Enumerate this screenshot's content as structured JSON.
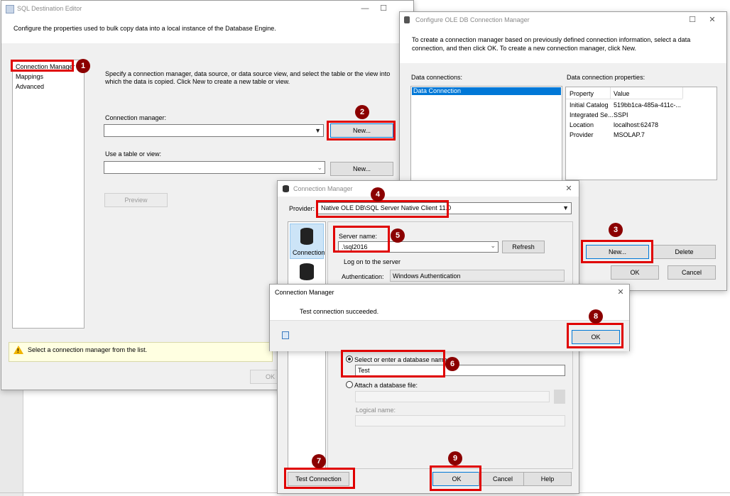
{
  "sql_editor": {
    "title": "SQL Destination Editor",
    "description": "Configure the properties used to bulk copy data into a local instance of the Database Engine.",
    "nav": [
      "Connection Manager",
      "Mappings",
      "Advanced"
    ],
    "instructions": "Specify a connection manager, data source, or data source view, and select the table or the view into which the data is copied. Click New to create a new table or view.",
    "conn_label": "Connection manager:",
    "new1": "New...",
    "table_label": "Use a table or view:",
    "new2": "New...",
    "preview": "Preview",
    "warning": "Select a connection manager from the list.",
    "ok_partial": "OK"
  },
  "oledb": {
    "title": "Configure OLE DB Connection Manager",
    "description": "To create a connection manager based on previously defined connection information, select a data connection, and then click OK. To create a new connection manager, click New.",
    "data_connections_label": "Data connections:",
    "data_connections": [
      "Data Connection"
    ],
    "props_label": "Data connection properties:",
    "props_headers": [
      "Property",
      "Value"
    ],
    "props": [
      {
        "p": "Initial Catalog",
        "v": "519bb1ca-485a-411c-..."
      },
      {
        "p": "Integrated Se...",
        "v": "SSPI"
      },
      {
        "p": "Location",
        "v": "localhost:62478"
      },
      {
        "p": "Provider",
        "v": "MSOLAP.7"
      }
    ],
    "new": "New...",
    "delete": "Delete",
    "ok": "OK",
    "cancel": "Cancel"
  },
  "conn_mgr": {
    "title": "Connection Manager",
    "provider_label": "Provider:",
    "provider": "Native OLE DB\\SQL Server Native Client 11.0",
    "side_connection": "Connection",
    "server_label": "Server name:",
    "server": ".\\sql2016",
    "refresh": "Refresh",
    "logon": "Log on to the server",
    "auth_label": "Authentication:",
    "auth": "Windows Authentication",
    "select_db": "Select or enter a database name:",
    "db": "Test",
    "attach": "Attach a database file:",
    "logical": "Logical name:",
    "test": "Test Connection",
    "ok": "OK",
    "cancel": "Cancel",
    "help": "Help"
  },
  "msg": {
    "title": "Connection Manager",
    "text": "Test connection succeeded.",
    "ok": "OK"
  },
  "badges": [
    "1",
    "2",
    "3",
    "4",
    "5",
    "6",
    "7",
    "8",
    "9"
  ],
  "colors": {
    "annotation": "#e00000",
    "badge": "#8b0000",
    "selection": "#0078d7"
  }
}
